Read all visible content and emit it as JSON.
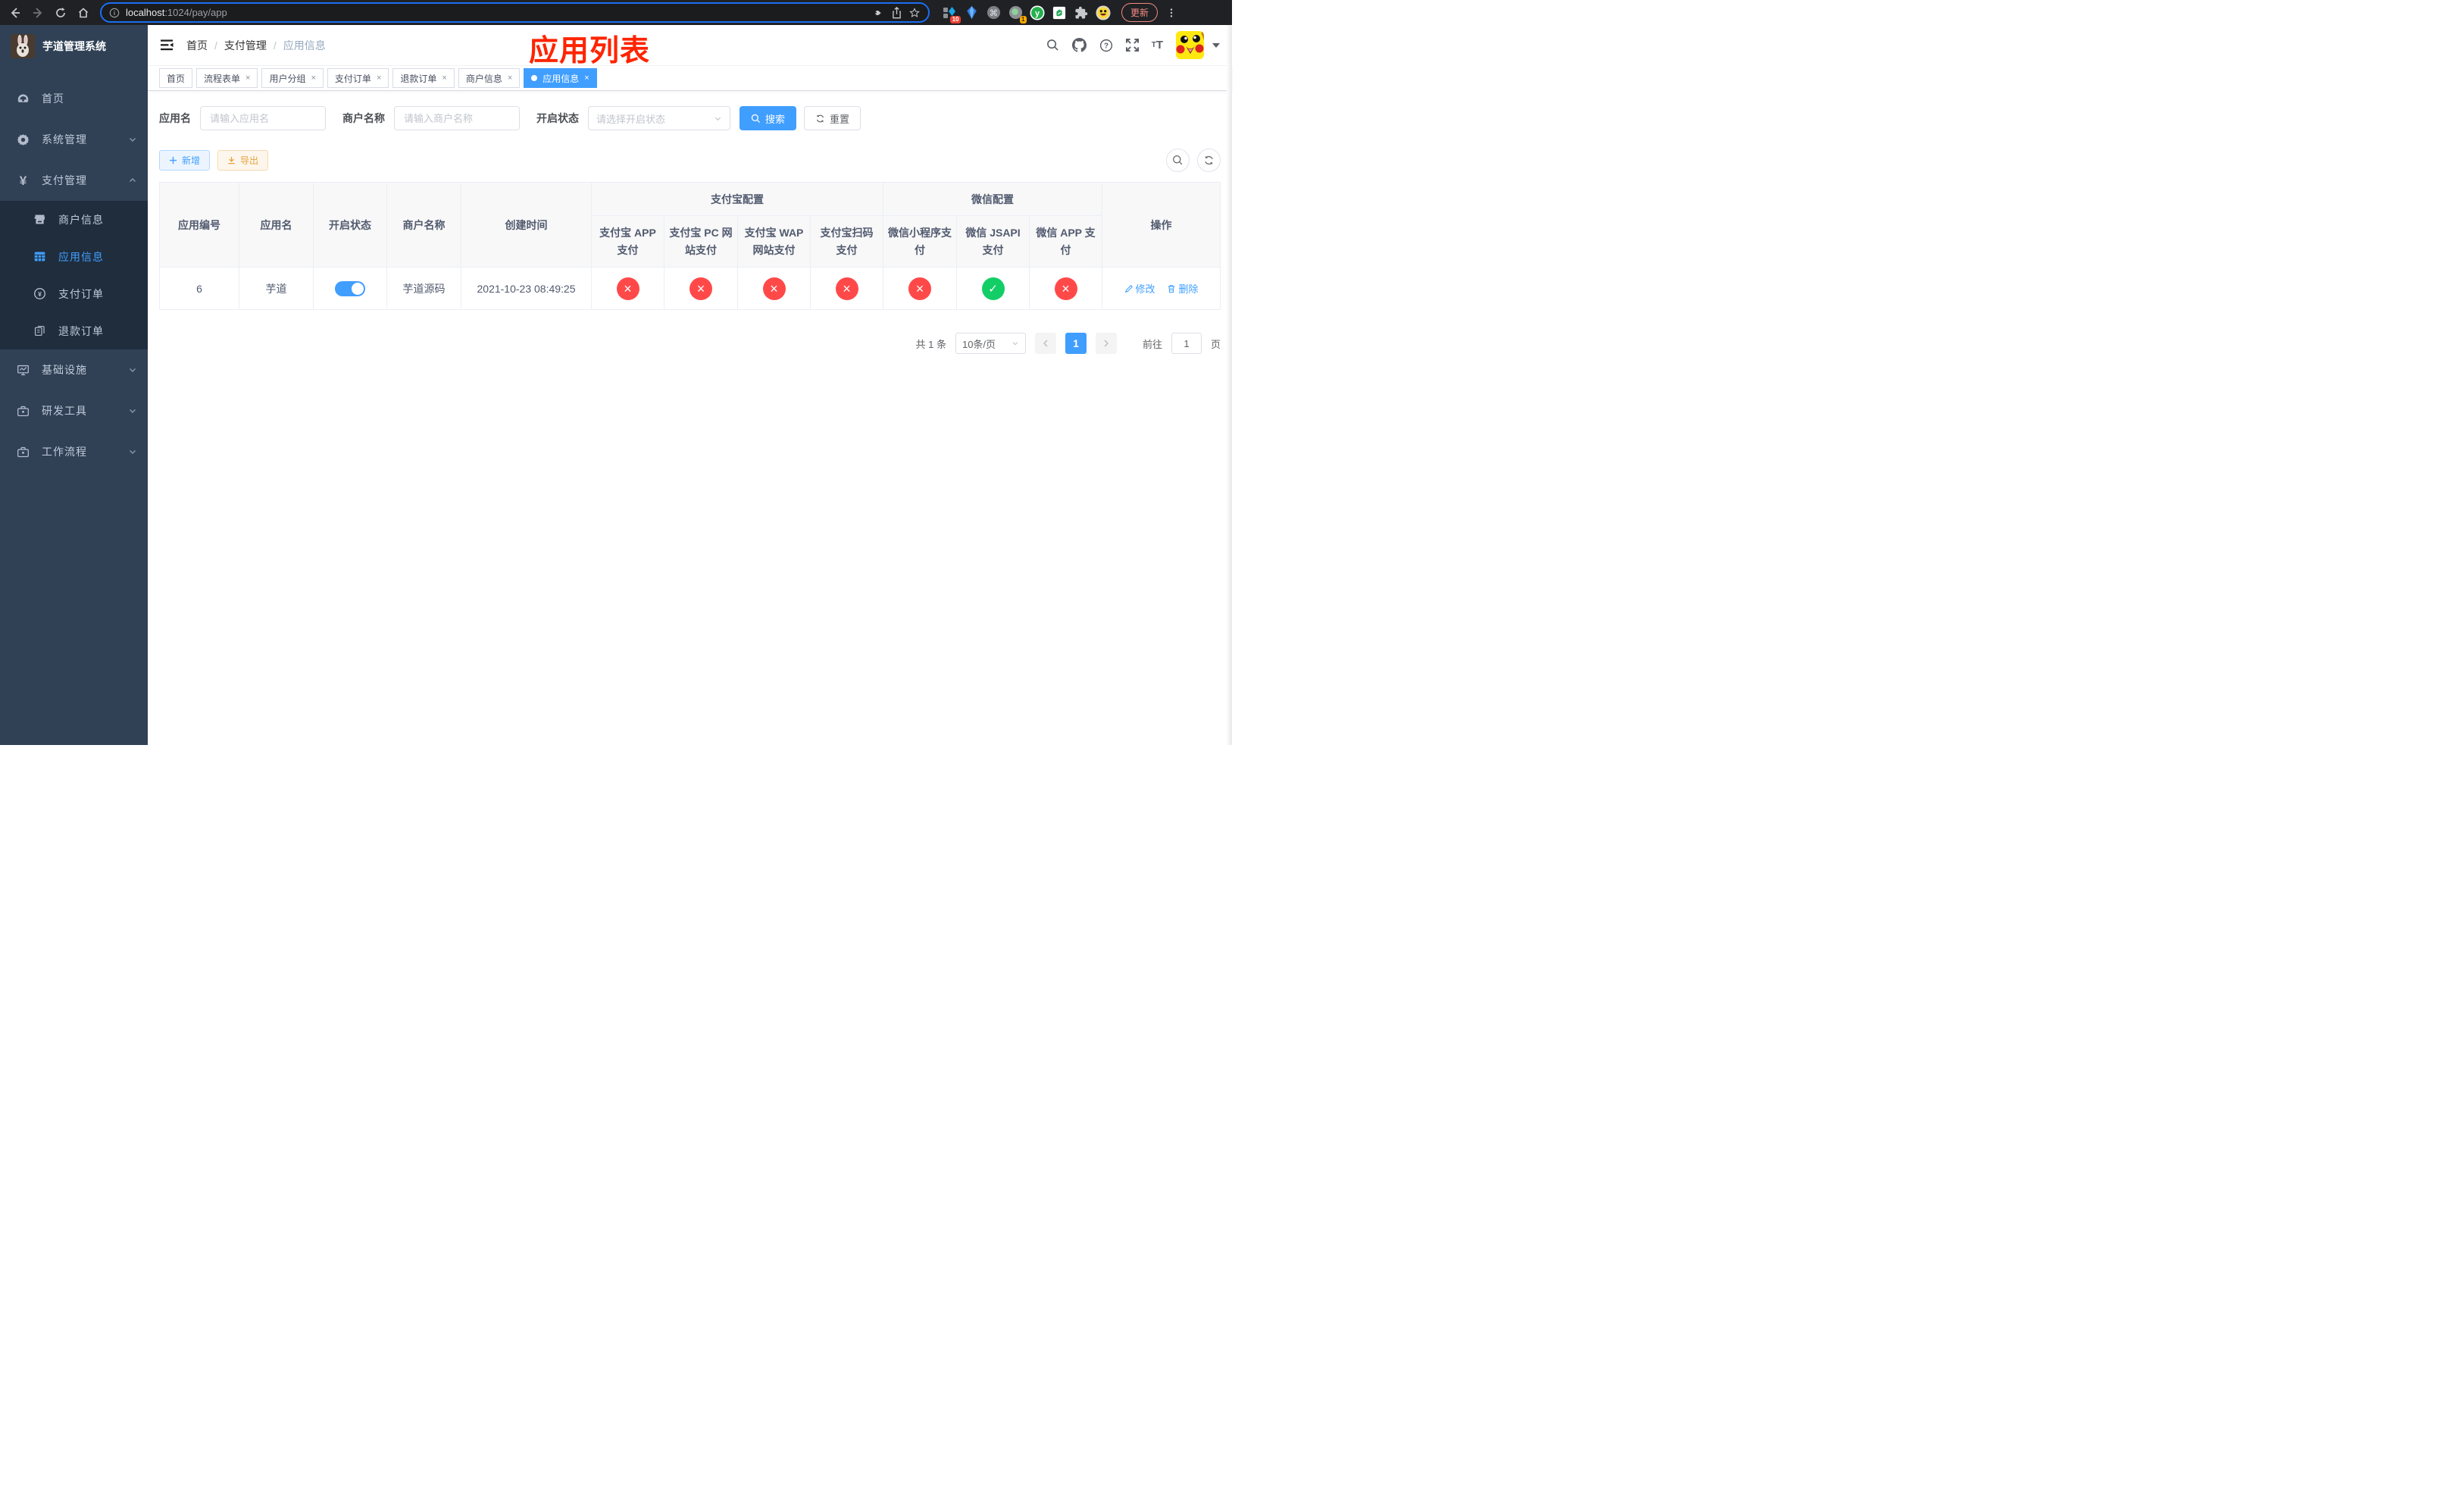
{
  "browser": {
    "url_host": "localhost",
    "url_path": ":1024/pay/app",
    "update_button": "更新",
    "ext_badges": {
      "pinned": "10",
      "tray": "1"
    }
  },
  "sidebar": {
    "logo_title": "芋道管理系统",
    "menu": [
      {
        "label": "首页"
      },
      {
        "label": "系统管理"
      },
      {
        "label": "支付管理"
      },
      {
        "label": "商户信息"
      },
      {
        "label": "应用信息"
      },
      {
        "label": "支付订单"
      },
      {
        "label": "退款订单"
      },
      {
        "label": "基础设施"
      },
      {
        "label": "研发工具"
      },
      {
        "label": "工作流程"
      }
    ]
  },
  "header": {
    "breadcrumb": [
      "首页",
      "支付管理",
      "应用信息"
    ],
    "annotation": "应用列表"
  },
  "tabs": [
    {
      "label": "首页"
    },
    {
      "label": "流程表单"
    },
    {
      "label": "用户分组"
    },
    {
      "label": "支付订单"
    },
    {
      "label": "退款订单"
    },
    {
      "label": "商户信息"
    },
    {
      "label": "应用信息"
    }
  ],
  "filters": {
    "app_name_label": "应用名",
    "app_name_placeholder": "请输入应用名",
    "merchant_label": "商户名称",
    "merchant_placeholder": "请输入商户名称",
    "status_label": "开启状态",
    "status_placeholder": "请选择开启状态",
    "search_button": "搜索",
    "reset_button": "重置"
  },
  "toolbar": {
    "add_button": "新增",
    "export_button": "导出"
  },
  "table": {
    "columns": [
      "应用编号",
      "应用名",
      "开启状态",
      "商户名称",
      "创建时间"
    ],
    "group_alipay": "支付宝配置",
    "group_wechat": "微信配置",
    "pay_columns": [
      "支付宝 APP 支付",
      "支付宝 PC 网站支付",
      "支付宝 WAP 网站支付",
      "支付宝扫码支付",
      "微信小程序支付",
      "微信 JSAPI 支付",
      "微信 APP 支付"
    ],
    "actions_column": "操作",
    "rows": [
      {
        "id": "6",
        "name": "芋道",
        "enabled": true,
        "merchant": "芋道源码",
        "created_at": "2021-10-23 08:49:25",
        "statuses": [
          false,
          false,
          false,
          false,
          false,
          true,
          false
        ],
        "actions": {
          "edit": "修改",
          "delete": "删除"
        }
      }
    ]
  },
  "pagination": {
    "total_text": "共 1 条",
    "page_size": "10条/页",
    "current_page": "1",
    "goto_label": "前往",
    "goto_value": "1",
    "page_unit": "页"
  },
  "colors": {
    "accent": "#409eff",
    "success": "#13ce66",
    "danger": "#ff4949",
    "sidebar_bg": "#304156",
    "submenu_bg": "#1f2d3d",
    "annotation": "#ff2400"
  }
}
